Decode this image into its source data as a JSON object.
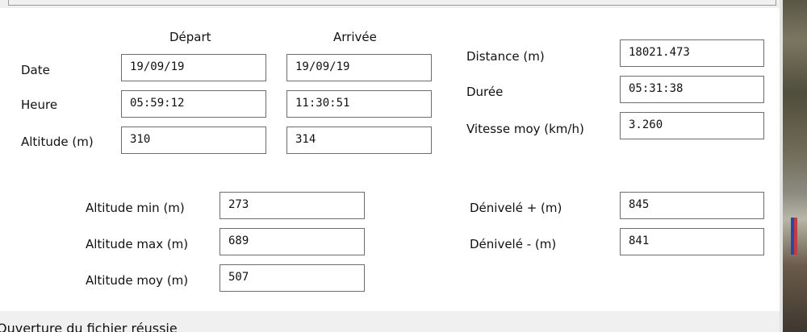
{
  "headers": {
    "depart": "Départ",
    "arrivee": "Arrivée"
  },
  "rows": {
    "date": {
      "label": "Date",
      "depart": "19/09/19",
      "arrivee": "19/09/19"
    },
    "heure": {
      "label": "Heure",
      "depart": "05:59:12",
      "arrivee": "11:30:51"
    },
    "altitude": {
      "label": "Altitude (m)",
      "depart": "310",
      "arrivee": "314"
    }
  },
  "summary": {
    "distance": {
      "label": "Distance (m)",
      "value": "18021.473"
    },
    "duree": {
      "label": "Durée",
      "value": "05:31:38"
    },
    "vitesse": {
      "label": "Vitesse moy (km/h)",
      "value": "3.260"
    }
  },
  "altitudes": {
    "min": {
      "label": "Altitude min (m)",
      "value": "273"
    },
    "max": {
      "label": "Altitude max (m)",
      "value": "689"
    },
    "moy": {
      "label": "Altitude moy (m)",
      "value": "507"
    }
  },
  "denivele": {
    "plus": {
      "label": "Dénivelé + (m)",
      "value": "845"
    },
    "minus": {
      "label": "Dénivelé - (m)",
      "value": "841"
    }
  },
  "footer": {
    "text": "Ouverture du fichier réussie"
  }
}
